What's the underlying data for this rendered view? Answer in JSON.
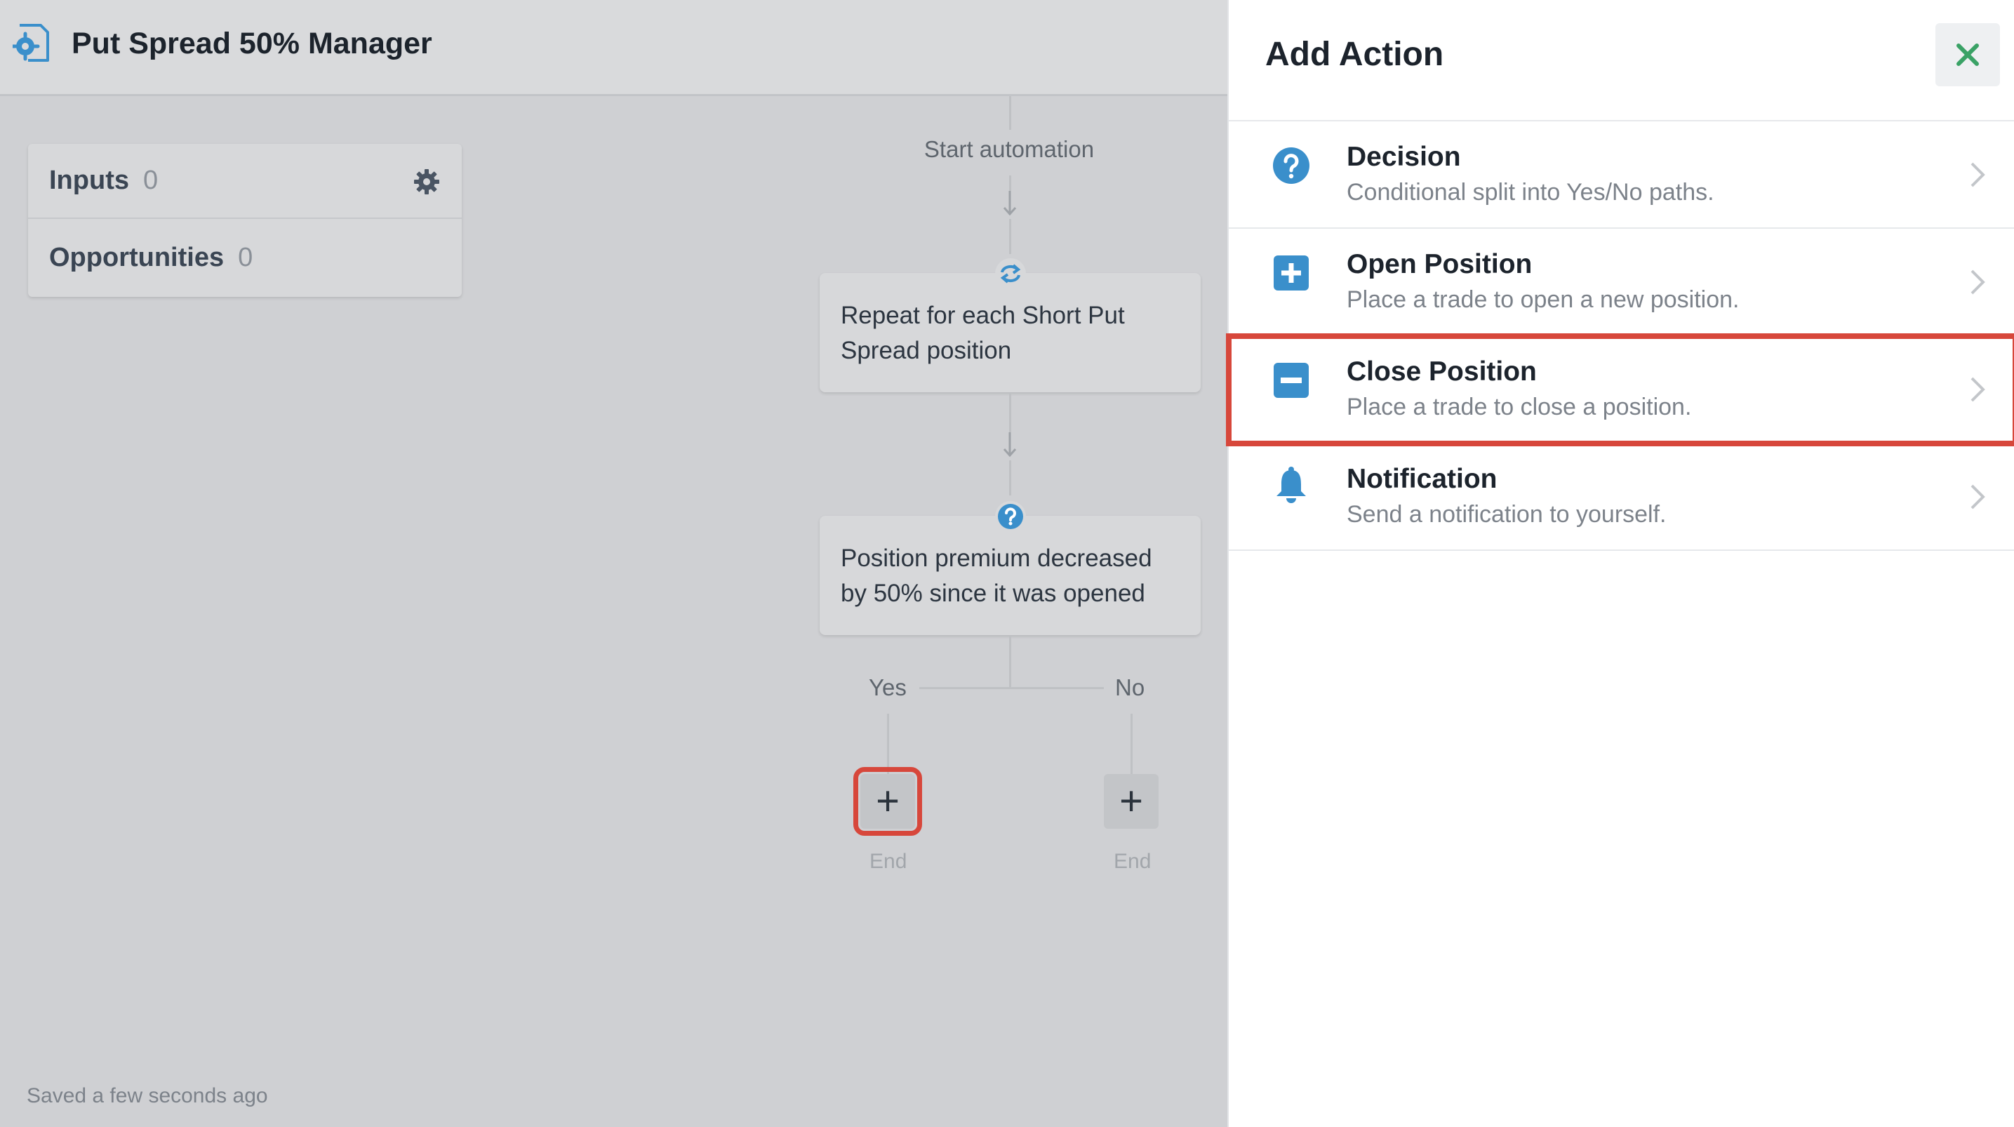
{
  "header": {
    "title": "Put Spread 50% Manager",
    "app_icon": "gear-document-icon"
  },
  "sidebar": {
    "items": [
      {
        "label": "Inputs",
        "count": "0"
      },
      {
        "label": "Opportunities",
        "count": "0"
      }
    ],
    "settings_icon": "gear-icon"
  },
  "flow": {
    "start_label": "Start automation",
    "loop_node": {
      "text": "Repeat for each Short Put Spread position",
      "icon": "repeat-icon"
    },
    "decision_node": {
      "text": "Position premium decreased by 50% since it was opened",
      "icon": "question-icon"
    },
    "yes_label": "Yes",
    "no_label": "No",
    "add_symbol": "+",
    "end_label_yes": "End",
    "end_label_no": "End"
  },
  "status": {
    "saved_text": "Saved a few seconds ago"
  },
  "panel": {
    "title": "Add Action",
    "close_icon": "close-icon",
    "actions": [
      {
        "title": "Decision",
        "description": "Conditional split into Yes/No paths.",
        "icon": "question-circle-icon"
      },
      {
        "title": "Open Position",
        "description": "Place a trade to open a new position.",
        "icon": "plus-square-icon"
      },
      {
        "title": "Close Position",
        "description": "Place a trade to close a position.",
        "icon": "minus-square-icon"
      },
      {
        "title": "Notification",
        "description": "Send a notification to yourself.",
        "icon": "bell-icon"
      }
    ]
  },
  "colors": {
    "accent_blue": "#3a8fcb",
    "highlight_red": "#d7473b",
    "close_green": "#3aa266"
  }
}
